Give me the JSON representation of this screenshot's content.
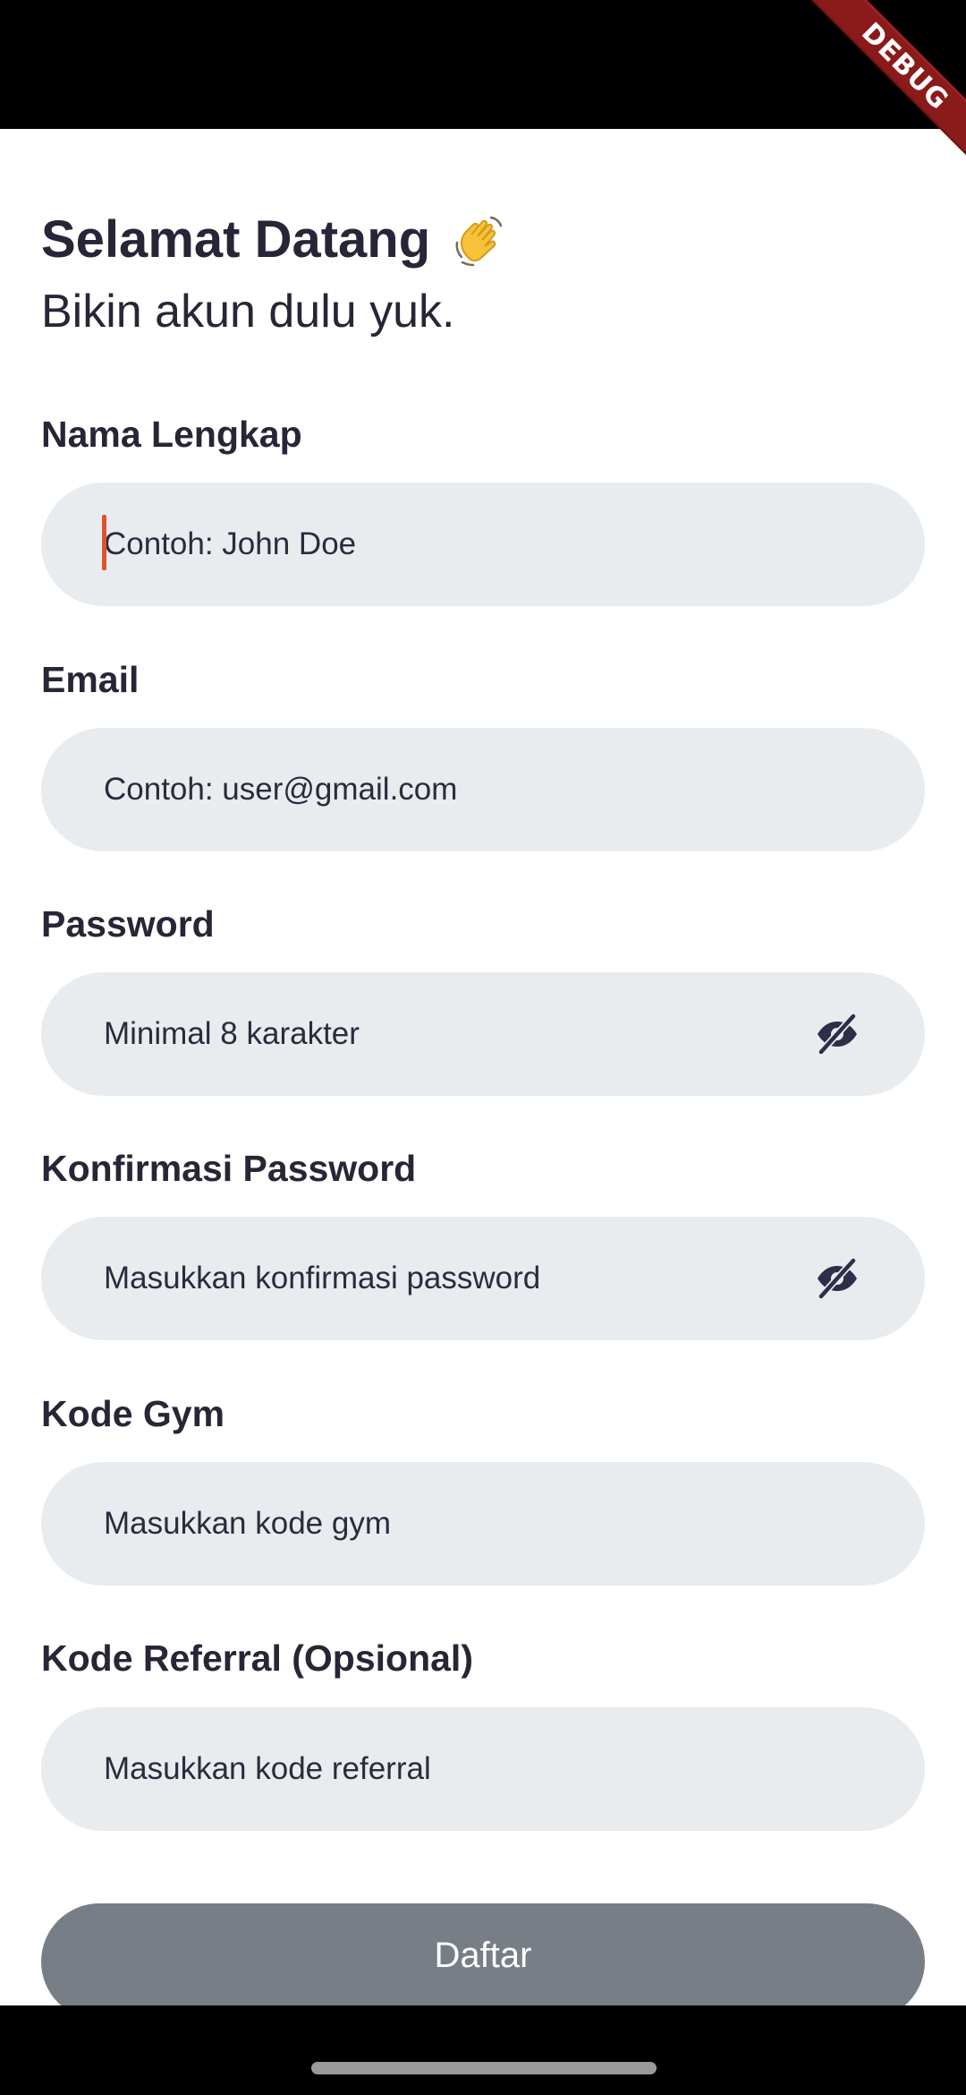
{
  "debug_banner": "DEBUG",
  "header": {
    "title": "Selamat Datang",
    "subtitle": "Bikin akun dulu yuk."
  },
  "form": {
    "full_name": {
      "label": "Nama Lengkap",
      "placeholder": "Contoh: John Doe"
    },
    "email": {
      "label": "Email",
      "placeholder": "Contoh: user@gmail.com"
    },
    "password": {
      "label": "Password",
      "placeholder": "Minimal 8 karakter",
      "toggle_icon": "eye-off-icon"
    },
    "confirm_password": {
      "label": "Konfirmasi Password",
      "placeholder": "Masukkan konfirmasi password",
      "toggle_icon": "eye-off-icon"
    },
    "gym_code": {
      "label": "Kode Gym",
      "placeholder": "Masukkan kode gym"
    },
    "referral_code": {
      "label": "Kode Referral (Opsional)",
      "placeholder": "Masukkan kode referral"
    }
  },
  "submit_button": {
    "label": "Daftar"
  },
  "colors": {
    "text": "#262637",
    "field_bg": "#e9ecef",
    "button_bg": "#777e85",
    "cursor": "#e2522c",
    "debug_banner": "#8b1a1a"
  }
}
